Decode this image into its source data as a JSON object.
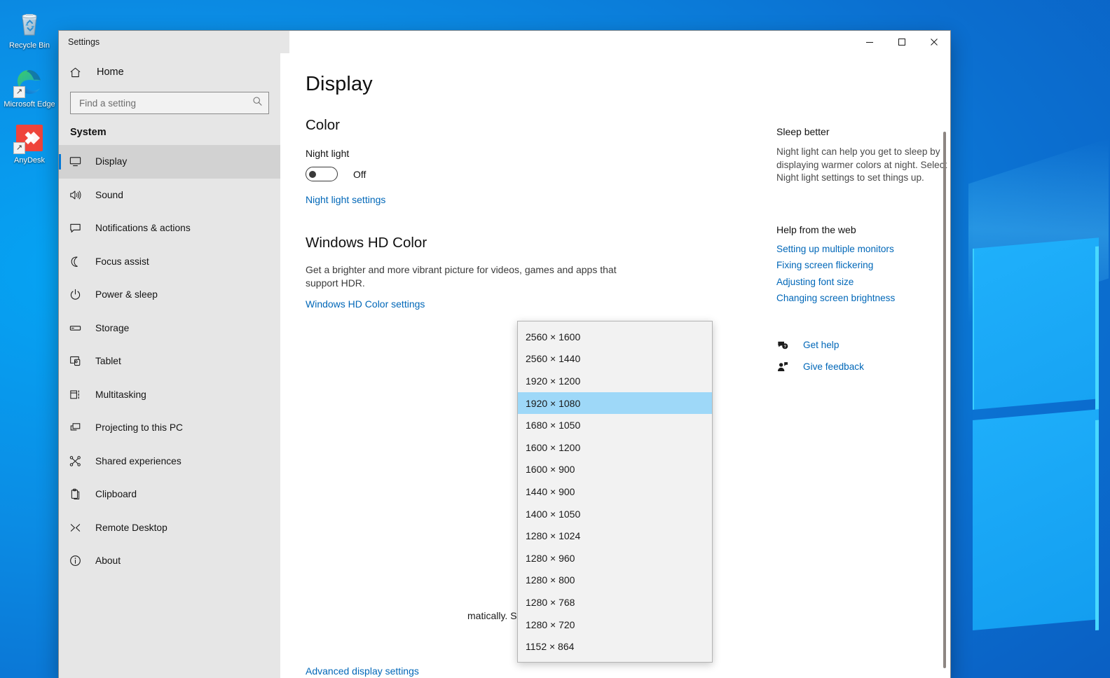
{
  "desktop": {
    "icons": [
      {
        "label": "Recycle Bin",
        "icon": "recycle-bin-icon",
        "shortcut": false
      },
      {
        "label": "Microsoft Edge",
        "icon": "microsoft-edge-icon",
        "shortcut": true
      },
      {
        "label": "AnyDesk",
        "icon": "anydesk-icon",
        "shortcut": true
      }
    ]
  },
  "window": {
    "title": "Settings",
    "controls": {
      "minimize": "minimize-icon",
      "maximize": "maximize-icon",
      "close": "close-icon"
    }
  },
  "sidebar": {
    "home_label": "Home",
    "home_icon": "home-icon",
    "search": {
      "placeholder": "Find a setting",
      "value": "",
      "icon": "search-icon"
    },
    "section_title": "System",
    "items": [
      {
        "label": "Display",
        "icon": "monitor-icon",
        "selected": true
      },
      {
        "label": "Sound",
        "icon": "speaker-icon",
        "selected": false
      },
      {
        "label": "Notifications & actions",
        "icon": "notification-icon",
        "selected": false
      },
      {
        "label": "Focus assist",
        "icon": "moon-icon",
        "selected": false
      },
      {
        "label": "Power & sleep",
        "icon": "power-icon",
        "selected": false
      },
      {
        "label": "Storage",
        "icon": "storage-icon",
        "selected": false
      },
      {
        "label": "Tablet",
        "icon": "tablet-icon",
        "selected": false
      },
      {
        "label": "Multitasking",
        "icon": "multitasking-icon",
        "selected": false
      },
      {
        "label": "Projecting to this PC",
        "icon": "projecting-icon",
        "selected": false
      },
      {
        "label": "Shared experiences",
        "icon": "share-icon",
        "selected": false
      },
      {
        "label": "Clipboard",
        "icon": "clipboard-icon",
        "selected": false
      },
      {
        "label": "Remote Desktop",
        "icon": "remote-desktop-icon",
        "selected": false
      },
      {
        "label": "About",
        "icon": "info-icon",
        "selected": false
      }
    ]
  },
  "main": {
    "page_title": "Display",
    "color_heading": "Color",
    "night_light_label": "Night light",
    "night_light_state": "Off",
    "night_light_settings_link": "Night light settings",
    "hd_color_heading": "Windows HD Color",
    "hd_color_description": "Get a brighter and more vibrant picture for videos, games and apps that support HDR.",
    "hd_color_settings_link": "Windows HD Color settings",
    "occluded_text": "matically. Select Detect to",
    "advanced_display_settings_link": "Advanced display settings"
  },
  "resolution_dropdown": {
    "selected": "1920 × 1080",
    "options": [
      "2560 × 1600",
      "2560 × 1440",
      "1920 × 1200",
      "1920 × 1080",
      "1680 × 1050",
      "1600 × 1200",
      "1600 × 900",
      "1440 × 900",
      "1400 × 1050",
      "1280 × 1024",
      "1280 × 960",
      "1280 × 800",
      "1280 × 768",
      "1280 × 720",
      "1152 × 864"
    ]
  },
  "aside": {
    "sleep_heading": "Sleep better",
    "sleep_text": "Night light can help you get to sleep by displaying warmer colors at night. Select Night light settings to set things up.",
    "help_heading": "Help from the web",
    "help_links": [
      "Setting up multiple monitors",
      "Fixing screen flickering",
      "Adjusting font size",
      "Changing screen brightness"
    ],
    "get_help_label": "Get help",
    "get_help_icon": "help-chat-icon",
    "give_feedback_label": "Give feedback",
    "give_feedback_icon": "feedback-person-icon"
  },
  "colors": {
    "accent": "#0078d7",
    "link": "#0067b8",
    "selection": "#9ed8f8",
    "sidebar_bg": "#e6e6e6",
    "desktop_blue": "#0a8ae0"
  }
}
